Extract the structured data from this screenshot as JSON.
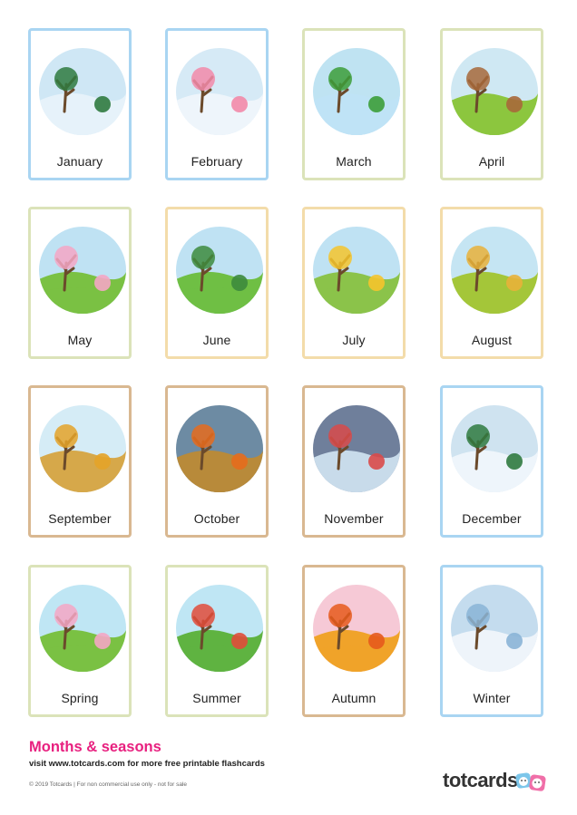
{
  "cards": [
    {
      "label": "January",
      "border": "#a9d5f2",
      "sky": "#cfe7f5",
      "ground": "#e6f2fa",
      "accent": "#2f7a3f",
      "icon": "snowy-tree-icon"
    },
    {
      "label": "February",
      "border": "#a9d5f2",
      "sky": "#d6eaf6",
      "ground": "#eef5fb",
      "accent": "#f28aa9",
      "icon": "love-letter-icon"
    },
    {
      "label": "March",
      "border": "#dbe3b9",
      "sky": "#bfe3f2",
      "ground": "#bfe3f6",
      "accent": "#3c9d3a",
      "icon": "clover-icon"
    },
    {
      "label": "April",
      "border": "#dbe3b9",
      "sky": "#cfe8f3",
      "ground": "#8cc63f",
      "accent": "#a7683a",
      "icon": "picnic-basket-icon"
    },
    {
      "label": "May",
      "border": "#dbe3b9",
      "sky": "#bfe2f3",
      "ground": "#7ac143",
      "accent": "#f4a6c4",
      "icon": "blossom-tree-icon"
    },
    {
      "label": "June",
      "border": "#f3dcaa",
      "sky": "#bfe2f3",
      "ground": "#6fbf44",
      "accent": "#3d8b3d",
      "icon": "green-tree-icon"
    },
    {
      "label": "July",
      "border": "#f3dcaa",
      "sky": "#bfe2f3",
      "ground": "#8bc34a",
      "accent": "#f5c42c",
      "icon": "sun-picnic-icon"
    },
    {
      "label": "August",
      "border": "#f3dcaa",
      "sky": "#c5e5f3",
      "ground": "#a4c639",
      "accent": "#e8b13a",
      "icon": "deckchair-icon"
    },
    {
      "label": "September",
      "border": "#d9b891",
      "sky": "#d5ecf6",
      "ground": "#d6a84a",
      "accent": "#e4a329",
      "icon": "autumn-tree-icon"
    },
    {
      "label": "October",
      "border": "#d9b891",
      "sky": "#6d8ba3",
      "ground": "#b88a3a",
      "accent": "#e66b1d",
      "icon": "pumpkin-icon"
    },
    {
      "label": "November",
      "border": "#d9b891",
      "sky": "#6f7f9b",
      "ground": "#c8dbea",
      "accent": "#d94a4a",
      "icon": "fireworks-icon"
    },
    {
      "label": "December",
      "border": "#a9d5f2",
      "sky": "#cfe3f0",
      "ground": "#eef5fb",
      "accent": "#2f7a3f",
      "icon": "christmas-tree-icon"
    },
    {
      "label": "Spring",
      "border": "#dbe3b9",
      "sky": "#bfe6f4",
      "ground": "#7ac143",
      "accent": "#f4a6c4",
      "icon": "spring-tree-icon"
    },
    {
      "label": "Summer",
      "border": "#dbe3b9",
      "sky": "#bfe6f4",
      "ground": "#5fb341",
      "accent": "#e04b3a",
      "icon": "summer-tree-icon"
    },
    {
      "label": "Autumn",
      "border": "#d9b891",
      "sky": "#f6c9d6",
      "ground": "#f0a32a",
      "accent": "#e65a1c",
      "icon": "autumn-leaves-tree-icon"
    },
    {
      "label": "Winter",
      "border": "#a9d5f2",
      "sky": "#c4dcee",
      "ground": "#eef4fa",
      "accent": "#8ab4d6",
      "icon": "winter-tree-icon"
    }
  ],
  "footer": {
    "title": "Months & seasons",
    "subtitle": "visit www.totcards.com for more free printable flashcards",
    "copyright": "© 2019 Totcards   |   For non commercial use only - not for sale",
    "brand": "totcards"
  },
  "colors": {
    "title_pink": "#e8207f"
  }
}
